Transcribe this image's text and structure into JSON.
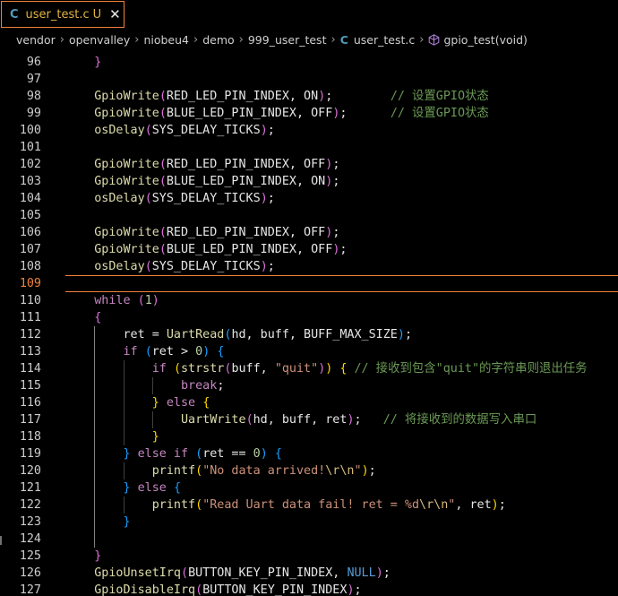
{
  "tab": {
    "icon": "c-file-icon",
    "icon_glyph": "C",
    "filename": "user_test.c",
    "status": "U",
    "close_glyph": "✕"
  },
  "breadcrumb": {
    "segments": [
      "vendor",
      "openvalley",
      "niobeu4",
      "demo",
      "999_user_test"
    ],
    "file_glyph": "C",
    "file": "user_test.c",
    "symbol": "gpio_test(void)"
  },
  "editor": {
    "current_line": 109,
    "lines": [
      {
        "n": 96,
        "t": [
          [
            "    ",
            "p"
          ],
          [
            "}",
            "b2"
          ]
        ]
      },
      {
        "n": 97,
        "t": []
      },
      {
        "n": 98,
        "t": [
          [
            "    ",
            "p"
          ],
          [
            "GpioWrite",
            "fn"
          ],
          [
            "(",
            "b2"
          ],
          [
            "RED_LED_PIN_INDEX, ON",
            "id"
          ],
          [
            ")",
            "b2"
          ],
          [
            ";        ",
            "p"
          ],
          [
            "// 设置GPIO状态",
            "cm"
          ]
        ]
      },
      {
        "n": 99,
        "t": [
          [
            "    ",
            "p"
          ],
          [
            "GpioWrite",
            "fn"
          ],
          [
            "(",
            "b2"
          ],
          [
            "BLUE_LED_PIN_INDEX, OFF",
            "id"
          ],
          [
            ")",
            "b2"
          ],
          [
            ";      ",
            "p"
          ],
          [
            "// 设置GPIO状态",
            "cm"
          ]
        ]
      },
      {
        "n": 100,
        "t": [
          [
            "    ",
            "p"
          ],
          [
            "osDelay",
            "fn"
          ],
          [
            "(",
            "b2"
          ],
          [
            "SYS_DELAY_TICKS",
            "id"
          ],
          [
            ")",
            "b2"
          ],
          [
            ";",
            "p"
          ]
        ]
      },
      {
        "n": 101,
        "t": []
      },
      {
        "n": 102,
        "t": [
          [
            "    ",
            "p"
          ],
          [
            "GpioWrite",
            "fn"
          ],
          [
            "(",
            "b2"
          ],
          [
            "RED_LED_PIN_INDEX, OFF",
            "id"
          ],
          [
            ")",
            "b2"
          ],
          [
            ";",
            "p"
          ]
        ]
      },
      {
        "n": 103,
        "t": [
          [
            "    ",
            "p"
          ],
          [
            "GpioWrite",
            "fn"
          ],
          [
            "(",
            "b2"
          ],
          [
            "BLUE_LED_PIN_INDEX, ON",
            "id"
          ],
          [
            ")",
            "b2"
          ],
          [
            ";",
            "p"
          ]
        ]
      },
      {
        "n": 104,
        "t": [
          [
            "    ",
            "p"
          ],
          [
            "osDelay",
            "fn"
          ],
          [
            "(",
            "b2"
          ],
          [
            "SYS_DELAY_TICKS",
            "id"
          ],
          [
            ")",
            "b2"
          ],
          [
            ";",
            "p"
          ]
        ]
      },
      {
        "n": 105,
        "t": []
      },
      {
        "n": 106,
        "t": [
          [
            "    ",
            "p"
          ],
          [
            "GpioWrite",
            "fn"
          ],
          [
            "(",
            "b2"
          ],
          [
            "RED_LED_PIN_INDEX, OFF",
            "id"
          ],
          [
            ")",
            "b2"
          ],
          [
            ";",
            "p"
          ]
        ]
      },
      {
        "n": 107,
        "t": [
          [
            "    ",
            "p"
          ],
          [
            "GpioWrite",
            "fn"
          ],
          [
            "(",
            "b2"
          ],
          [
            "BLUE_LED_PIN_INDEX, OFF",
            "id"
          ],
          [
            ")",
            "b2"
          ],
          [
            ";",
            "p"
          ]
        ]
      },
      {
        "n": 108,
        "t": [
          [
            "    ",
            "p"
          ],
          [
            "osDelay",
            "fn"
          ],
          [
            "(",
            "b2"
          ],
          [
            "SYS_DELAY_TICKS",
            "id"
          ],
          [
            ")",
            "b2"
          ],
          [
            ";",
            "p"
          ]
        ]
      },
      {
        "n": 109,
        "t": []
      },
      {
        "n": 110,
        "t": [
          [
            "    ",
            "p"
          ],
          [
            "while",
            "kw"
          ],
          [
            " ",
            "p"
          ],
          [
            "(",
            "b2"
          ],
          [
            "1",
            "num"
          ],
          [
            ")",
            "b2"
          ]
        ]
      },
      {
        "n": 111,
        "t": [
          [
            "    ",
            "p"
          ],
          [
            "{",
            "b2"
          ]
        ]
      },
      {
        "n": 112,
        "t": [
          [
            "        ",
            "p"
          ],
          [
            "ret = ",
            "id"
          ],
          [
            "UartRead",
            "fn"
          ],
          [
            "(",
            "b3"
          ],
          [
            "hd, buff, BUFF_MAX_SIZE",
            "id"
          ],
          [
            ")",
            "b3"
          ],
          [
            ";",
            "p"
          ]
        ]
      },
      {
        "n": 113,
        "t": [
          [
            "        ",
            "p"
          ],
          [
            "if",
            "kw"
          ],
          [
            " ",
            "p"
          ],
          [
            "(",
            "b3"
          ],
          [
            "ret > ",
            "id"
          ],
          [
            "0",
            "num"
          ],
          [
            ")",
            "b3"
          ],
          [
            " ",
            "p"
          ],
          [
            "{",
            "b3"
          ]
        ]
      },
      {
        "n": 114,
        "t": [
          [
            "            ",
            "p"
          ],
          [
            "if",
            "kw"
          ],
          [
            " ",
            "p"
          ],
          [
            "(",
            "b1"
          ],
          [
            "strstr",
            "fn"
          ],
          [
            "(",
            "b2"
          ],
          [
            "buff, ",
            "id"
          ],
          [
            "\"quit\"",
            "str"
          ],
          [
            ")",
            "b2"
          ],
          [
            ")",
            "b1"
          ],
          [
            " ",
            "p"
          ],
          [
            "{",
            "b1"
          ],
          [
            " ",
            "p"
          ],
          [
            "// 接收到包含\"quit\"的字符串则退出任务",
            "cm"
          ]
        ]
      },
      {
        "n": 115,
        "t": [
          [
            "                ",
            "p"
          ],
          [
            "break",
            "kw"
          ],
          [
            ";",
            "p"
          ]
        ]
      },
      {
        "n": 116,
        "t": [
          [
            "            ",
            "p"
          ],
          [
            "}",
            "b1"
          ],
          [
            " ",
            "p"
          ],
          [
            "else",
            "kw"
          ],
          [
            " ",
            "p"
          ],
          [
            "{",
            "b1"
          ]
        ]
      },
      {
        "n": 117,
        "t": [
          [
            "                ",
            "p"
          ],
          [
            "UartWrite",
            "fn"
          ],
          [
            "(",
            "b2"
          ],
          [
            "hd, buff, ret",
            "id"
          ],
          [
            ")",
            "b2"
          ],
          [
            ";   ",
            "p"
          ],
          [
            "// 将接收到的数据写入串口",
            "cm"
          ]
        ]
      },
      {
        "n": 118,
        "t": [
          [
            "            ",
            "p"
          ],
          [
            "}",
            "b1"
          ]
        ]
      },
      {
        "n": 119,
        "t": [
          [
            "        ",
            "p"
          ],
          [
            "}",
            "b3"
          ],
          [
            " ",
            "p"
          ],
          [
            "else if",
            "kw"
          ],
          [
            " ",
            "p"
          ],
          [
            "(",
            "b3"
          ],
          [
            "ret == ",
            "id"
          ],
          [
            "0",
            "num"
          ],
          [
            ")",
            "b3"
          ],
          [
            " ",
            "p"
          ],
          [
            "{",
            "b3"
          ]
        ]
      },
      {
        "n": 120,
        "t": [
          [
            "            ",
            "p"
          ],
          [
            "printf",
            "fn"
          ],
          [
            "(",
            "b1"
          ],
          [
            "\"No data arrived!",
            "str"
          ],
          [
            "\\r\\n",
            "esc"
          ],
          [
            "\"",
            "str"
          ],
          [
            ")",
            "b1"
          ],
          [
            ";",
            "p"
          ]
        ]
      },
      {
        "n": 121,
        "t": [
          [
            "        ",
            "p"
          ],
          [
            "}",
            "b3"
          ],
          [
            " ",
            "p"
          ],
          [
            "else",
            "kw"
          ],
          [
            " ",
            "p"
          ],
          [
            "{",
            "b3"
          ]
        ]
      },
      {
        "n": 122,
        "t": [
          [
            "            ",
            "p"
          ],
          [
            "printf",
            "fn"
          ],
          [
            "(",
            "b1"
          ],
          [
            "\"Read Uart data fail! ret = %d",
            "str"
          ],
          [
            "\\r\\n",
            "esc"
          ],
          [
            "\"",
            "str"
          ],
          [
            ", ret",
            "id"
          ],
          [
            ")",
            "b1"
          ],
          [
            ";",
            "p"
          ]
        ]
      },
      {
        "n": 123,
        "t": [
          [
            "        ",
            "p"
          ],
          [
            "}",
            "b3"
          ]
        ]
      },
      {
        "n": 124,
        "t": []
      },
      {
        "n": 125,
        "t": [
          [
            "    ",
            "p"
          ],
          [
            "}",
            "b2"
          ]
        ]
      },
      {
        "n": 126,
        "t": [
          [
            "    ",
            "p"
          ],
          [
            "GpioUnsetIrq",
            "fn"
          ],
          [
            "(",
            "b2"
          ],
          [
            "BUTTON_KEY_PIN_INDEX, ",
            "id"
          ],
          [
            "NULL",
            "cn"
          ],
          [
            ")",
            "b2"
          ],
          [
            ";",
            "p"
          ]
        ]
      },
      {
        "n": 127,
        "t": [
          [
            "    ",
            "p"
          ],
          [
            "GpioDisableIrq",
            "fn"
          ],
          [
            "(",
            "b2"
          ],
          [
            "BUTTON_KEY_PIN_INDEX",
            "id"
          ],
          [
            ")",
            "b2"
          ],
          [
            ";",
            "p"
          ]
        ]
      }
    ]
  }
}
